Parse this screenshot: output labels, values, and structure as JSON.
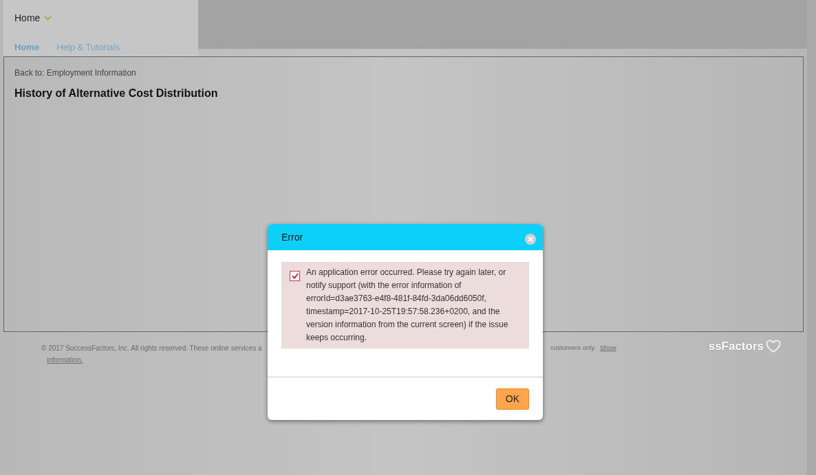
{
  "header": {
    "menu": {
      "label": "Home"
    },
    "tabs": [
      {
        "label": "Home",
        "selected": true
      },
      {
        "label": "Help & Tutorials",
        "selected": false
      }
    ]
  },
  "page": {
    "back_link": "Back to: Employment Information",
    "title": "History of Alternative Cost Distribution"
  },
  "footer": {
    "copyright_start": "© 2017 SuccessFactors, Inc. All rights reserved. These online services a",
    "copyright_end": "customers only.",
    "link": "Show",
    "link_2": "information.",
    "logo": "ssFactors"
  },
  "dialog": {
    "title": "Error",
    "message": {
      "checked": true,
      "text": "An application error occurred. Please try again later, or notify support (with the error information of errorId=d3ae3763-e4f8-481f-84fd-3da06dd6050f, timestamp=2017-10-25T19:57:58.236+0200, and the version information from the current screen) if the issue keeps occurring."
    },
    "buttons": [
      "OK"
    ]
  }
}
